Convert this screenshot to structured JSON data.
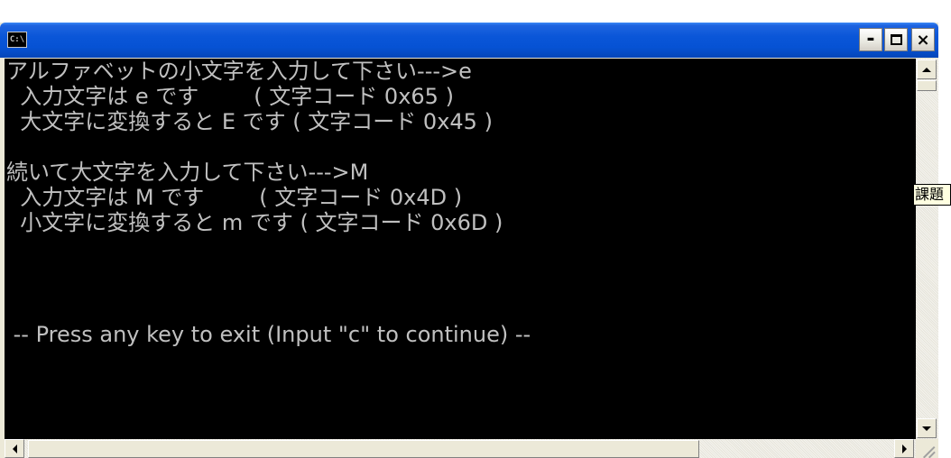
{
  "window": {
    "icon_text": "C:\\",
    "title": "",
    "buttons": {
      "minimize": "-",
      "close": "×"
    }
  },
  "console": {
    "lines": [
      "アルファベットの小文字を入力して下さい--->e",
      "  入力文字は e です        ( 文字コード 0x65 )",
      "  大文字に変換すると E です ( 文字コード 0x45 )",
      "",
      "続いて大文字を入力して下さい--->M",
      "  入力文字は M です        ( 文字コード 0x4D )",
      "  小文字に変換すると m です ( 文字コード 0x6D )",
      "",
      "",
      " -- Press any key to exit (Input \"c\" to continue) --"
    ]
  },
  "tooltip": {
    "text": "課題"
  },
  "colors": {
    "titlebar": "#0a56d8",
    "console_bg": "#000000",
    "console_text": "#c0c0c0",
    "tooltip_bg": "#ffffe1"
  }
}
